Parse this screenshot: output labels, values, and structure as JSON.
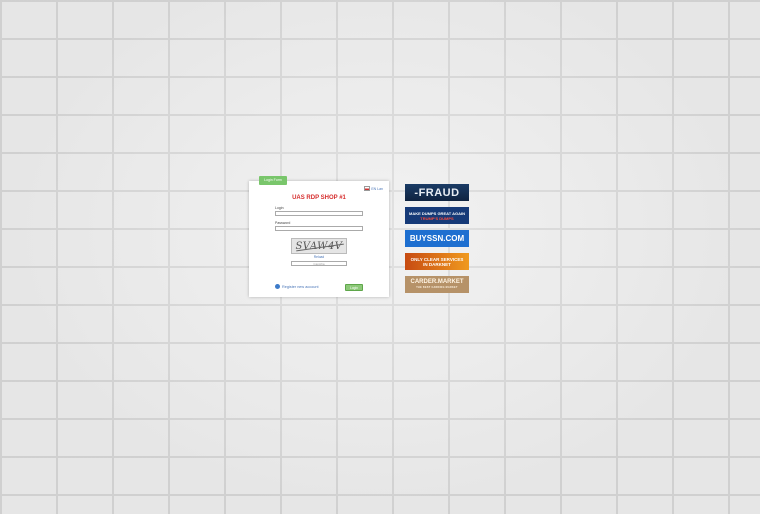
{
  "panel": {
    "tab_label": "Login Form",
    "lang_label": "EN Lan",
    "title": "UAS RDP SHOP #1",
    "login_label": "Login",
    "password_label": "Password",
    "captcha_text": "SVAW4V",
    "reload_label": "Reload",
    "code_placeholder": "Captcha",
    "register_label": "Register new account",
    "login_button": "Login"
  },
  "banners": {
    "b1": "-FRAUD",
    "b2_line1": "MAKE DUMPS GREAT AGAIN",
    "b2_line2": "TRUMP'S DUMPS",
    "b3": "BUYSSN.COM",
    "b4_line1": "ONLY CLEAR SERVICES",
    "b4_line2": "IN DARKNET",
    "b5_line1": "CARDER.MARKET",
    "b5_line2": "THE BEST CARDING MARKET"
  },
  "colors": {
    "title_red": "#d62e2e",
    "button_green": "#8cc878",
    "link_blue": "#4a76b8",
    "background": "#ebebeb"
  }
}
